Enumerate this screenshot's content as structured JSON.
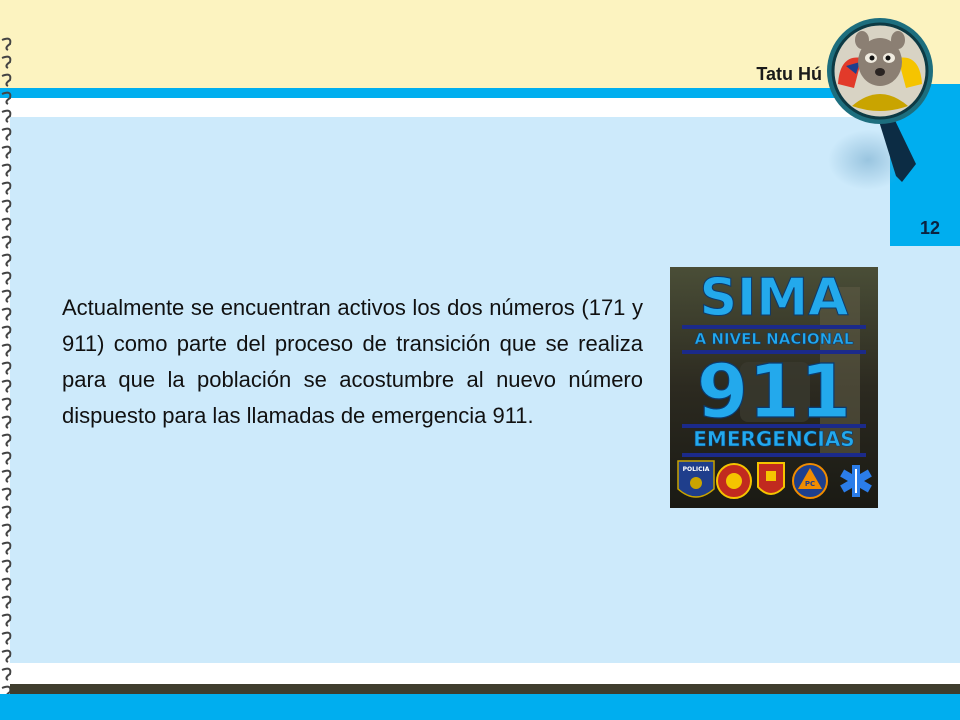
{
  "header": {
    "brand_name": "Tatu Hú",
    "page_number": "12"
  },
  "content": {
    "paragraph": "Actualmente se encuentran activos los dos números (171 y 911) como parte del proceso de transición que se realiza para que la población se acostumbre al nuevo número dispuesto para las llamadas de emergencia 911."
  },
  "poster": {
    "title": "SIMA",
    "subtitle": "A NIVEL NACIONAL",
    "number": "911",
    "caption": "EMERGENCIAS",
    "badge_text_policia": "POLICIA",
    "badge_text_pc": "PC"
  },
  "colors": {
    "accent_blue": "#00aeef",
    "panel_blue": "#cdeafb",
    "header_cream": "#fcf3c0",
    "footer_dark": "#3f3d2e"
  },
  "icons": [
    "spiral-binding-icon",
    "mascot-logo-icon",
    "star-of-life-icon"
  ]
}
